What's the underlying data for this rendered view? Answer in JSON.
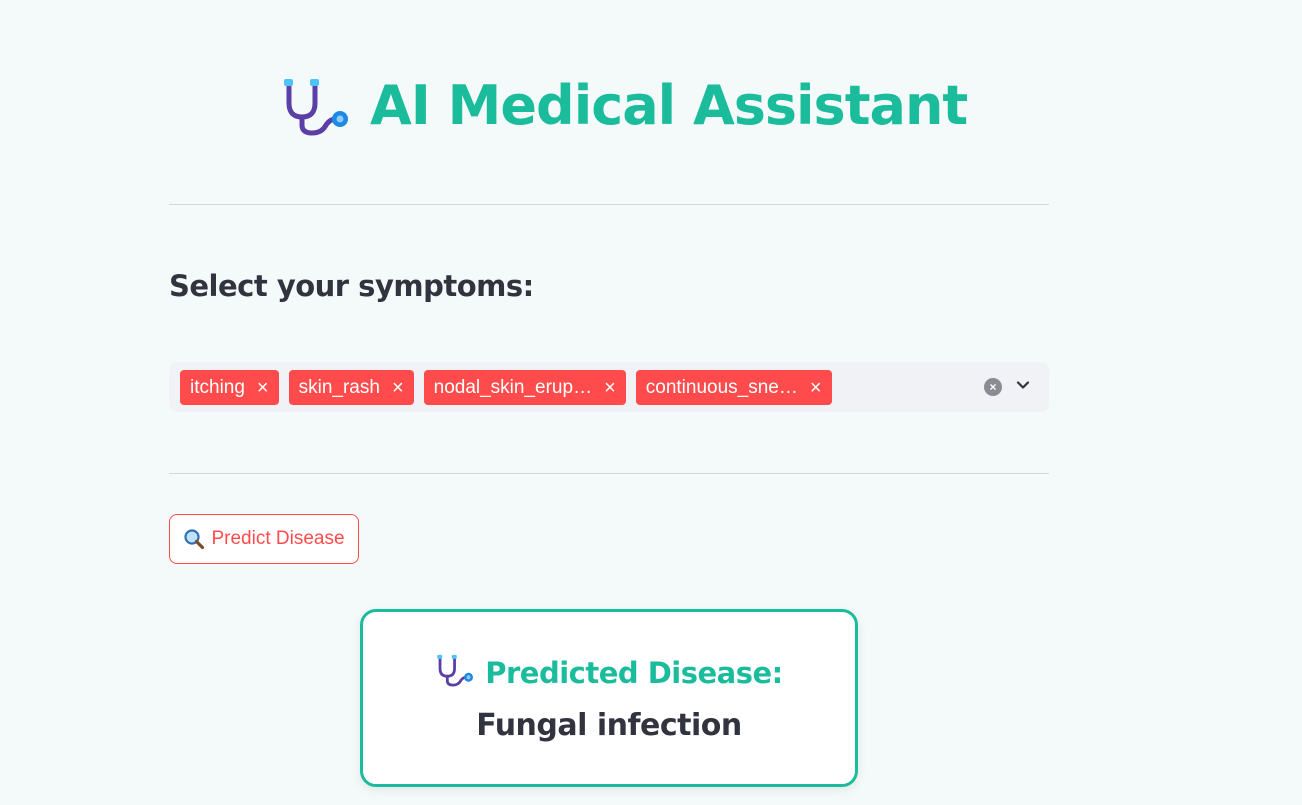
{
  "header": {
    "title": "AI Medical Assistant",
    "icon": "stethoscope-icon"
  },
  "symptoms": {
    "label": "Select your symptoms:",
    "selected": [
      "itching",
      "skin_rash",
      "nodal_skin_erup…",
      "continuous_sne…"
    ],
    "remove_glyph": "×",
    "clear_glyph": "×"
  },
  "predict_button": {
    "label": "Predict Disease",
    "icon": "magnifier-icon"
  },
  "result": {
    "heading": "Predicted Disease:",
    "value": "Fungal infection",
    "icon": "stethoscope-icon"
  },
  "colors": {
    "accent": "#1abc9c",
    "primary": "#ff4b4b",
    "background": "#f4f9f9",
    "text": "#31333f"
  }
}
